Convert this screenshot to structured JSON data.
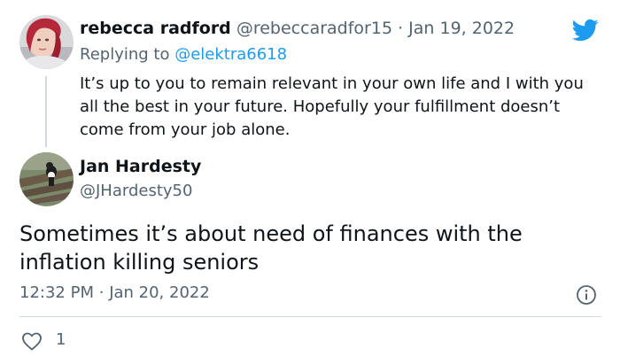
{
  "reply_tweet": {
    "author_name": "rebecca radford",
    "author_handle": "@rebeccaradfor15",
    "separator": "·",
    "date": "Jan 19, 2022",
    "replying_prefix": "Replying to",
    "replying_to": "@elektra6618",
    "text": "It’s up to you to remain relevant in your own life and I with you all the best in your future. Hopefully your fulfillment doesn’t come from your job alone."
  },
  "main_tweet": {
    "author_name": "Jan Hardesty",
    "author_handle": "@JHardesty50",
    "text": "Sometimes it’s about need of finances with the inflation killing seniors",
    "time": "12:32 PM",
    "separator": "·",
    "date": "Jan 20, 2022",
    "like_count": "1"
  },
  "icons": {
    "brand": "twitter-bird-icon",
    "info": "info-icon",
    "like": "heart-icon"
  },
  "colors": {
    "brand_blue": "#1d9bf0",
    "text": "#0f1419",
    "muted": "#536471",
    "divider": "#cfd9de"
  }
}
